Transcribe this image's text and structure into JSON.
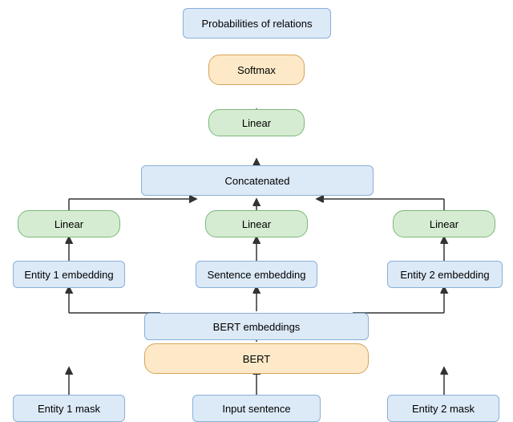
{
  "nodes": {
    "probabilities": {
      "label": "Probabilities of relations"
    },
    "softmax": {
      "label": "Softmax"
    },
    "linear_top": {
      "label": "Linear"
    },
    "concatenated": {
      "label": "Concatenated"
    },
    "linear_left": {
      "label": "Linear"
    },
    "linear_mid": {
      "label": "Linear"
    },
    "linear_right": {
      "label": "Linear"
    },
    "entity1_embed": {
      "label": "Entity 1 embedding"
    },
    "sentence_embed": {
      "label": "Sentence embedding"
    },
    "entity2_embed": {
      "label": "Entity 2 embedding"
    },
    "bert_embed": {
      "label": "BERT embeddings"
    },
    "bert": {
      "label": "BERT"
    },
    "entity1_mask": {
      "label": "Entity 1 mask"
    },
    "input_sentence": {
      "label": "Input sentence"
    },
    "entity2_mask": {
      "label": "Entity 2 mask"
    }
  }
}
